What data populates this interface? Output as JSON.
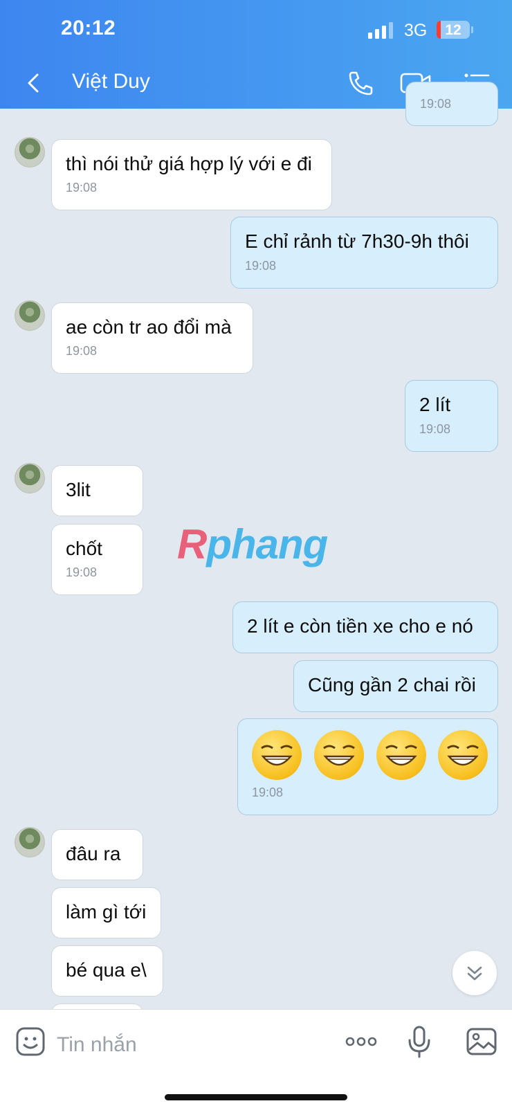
{
  "status": {
    "time": "20:12",
    "network": "3G",
    "battery": "12"
  },
  "header": {
    "title": "Việt Duy",
    "back_icon": "chevron-left-icon",
    "call_icon": "phone-icon",
    "video_icon": "video-icon",
    "menu_icon": "list-menu-icon"
  },
  "messages": {
    "m0_time": "19:08",
    "m1": {
      "text": "thì nói thử giá hợp lý với e đi",
      "time": "19:08"
    },
    "m2": {
      "text": "E chỉ rảnh từ 7h30-9h thôi",
      "time": "19:08"
    },
    "m3": {
      "text": "ae còn tr ao đổi mà",
      "time": "19:08"
    },
    "m4": {
      "text": "2 lít",
      "time": "19:08"
    },
    "m5": {
      "text": "3lit"
    },
    "m6": {
      "text": "chốt",
      "time": "19:08"
    },
    "m7": {
      "text": "2 lít e còn tiền xe cho e nó"
    },
    "m8": {
      "text": "Cũng gần 2 chai rồi"
    },
    "m9": {
      "emoji": "grinning-face x4",
      "time": "19:08"
    },
    "m10": {
      "text": "đâu ra"
    },
    "m11": {
      "text": "làm gì tới"
    },
    "m12": {
      "text": "bé qua e\\"
    }
  },
  "watermark": {
    "part1": "R",
    "part2": "phang"
  },
  "input": {
    "placeholder": "Tin nhắn"
  },
  "colors": {
    "header_start": "#3d86f0",
    "header_end": "#4ba6f0",
    "outgoing_bubble": "#d7eefc",
    "incoming_bubble": "#ffffff",
    "chat_bg": "#e2e8f0"
  }
}
